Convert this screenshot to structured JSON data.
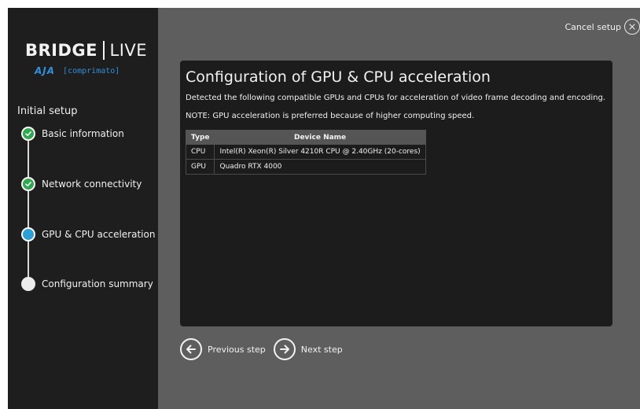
{
  "sidebar": {
    "logo": {
      "brand": "BRIDGE",
      "product": "LIVE",
      "partner_mark": "AJA",
      "partner_name": "[comprimato]"
    },
    "setup_title": "Initial setup",
    "steps": [
      {
        "label": "Basic information",
        "status": "done"
      },
      {
        "label": "Network connectivity",
        "status": "done"
      },
      {
        "label": "GPU & CPU acceleration",
        "status": "active"
      },
      {
        "label": "Configuration summary",
        "status": "pending"
      }
    ]
  },
  "header": {
    "cancel_label": "Cancel setup"
  },
  "panel": {
    "title": "Configuration of GPU & CPU acceleration",
    "description": "Detected the following compatible GPUs and CPUs for acceleration of video frame decoding and encoding.",
    "note": "NOTE: GPU acceleration is preferred because of higher computing speed.",
    "table": {
      "headers": [
        "Type",
        "Device Name"
      ],
      "rows": [
        [
          "CPU",
          "Intel(R) Xeon(R) Silver 4210R CPU @ 2.40GHz (20-cores)"
        ],
        [
          "GPU",
          "Quadro RTX 4000"
        ]
      ]
    }
  },
  "navigation": {
    "previous_label": "Previous step",
    "next_label": "Next step"
  },
  "colors": {
    "sidebar_bg": "#1e1e1e",
    "main_bg": "#5e5e5e",
    "panel_bg": "#1c1c1c",
    "step_done": "#2fa84f",
    "step_active": "#2a9fd8",
    "brand_blue": "#2f8fd8"
  }
}
